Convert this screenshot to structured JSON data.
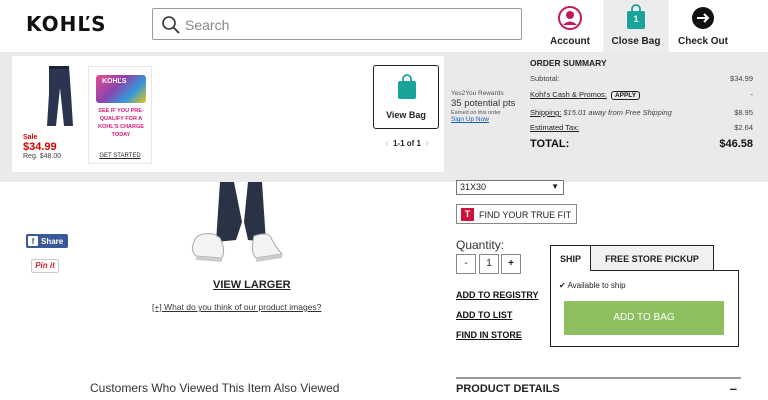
{
  "header": {
    "logo": "KOHĽS",
    "search_placeholder": "Search",
    "account_label": "Account",
    "close_bag_label": "Close Bag",
    "bag_count": "1",
    "checkout_label": "Check Out"
  },
  "bag": {
    "item": {
      "sale_label": "Sale",
      "sale_price": "$34.99",
      "reg_price": "Reg. $48.00"
    },
    "card_promo": {
      "logo_text": "KOHĽS",
      "text": "SEE IF YOU PRE-QUALIFY FOR A KOHL'S CHARGE TODAY",
      "cta": "GET STARTED"
    },
    "view_bag_label": "View Bag",
    "pager": "1-1 of 1"
  },
  "rewards": {
    "title": "Yes2You Rewards",
    "points": "35 potential pts",
    "note": "Earned on this order",
    "signup": "Sign Up Now"
  },
  "order_summary": {
    "title": "ORDER SUMMARY",
    "subtotal_label": "Subtotal:",
    "subtotal_value": "$34.99",
    "promos_label": "Kohl's Cash & Promos:",
    "apply_label": "APPLY",
    "promos_value": "-",
    "shipping_label": "Shipping:",
    "shipping_note": "$15.01 away from Free Shipping",
    "shipping_value": "$8.95",
    "tax_label": "Estimated Tax:",
    "tax_value": "$2.64",
    "total_label": "TOTAL:",
    "total_value": "$46.58"
  },
  "product": {
    "share_label": "Share",
    "pin_label": "Pin it",
    "view_larger": "VIEW LARGER",
    "feedback_link": "[+] What do you think of our product images?",
    "also_viewed": "Customers Who Viewed This Item Also Viewed",
    "size_value": "31X30",
    "truefit_label": "FIND YOUR TRUE FIT",
    "quantity_label": "Quantity:",
    "qty_minus": "-",
    "qty_value": "1",
    "qty_plus": "+",
    "add_to_registry": "ADD TO REGISTRY",
    "add_to_list": "ADD TO LIST",
    "find_in_store": "FIND IN STORE",
    "tab_ship": "SHIP",
    "tab_pickup": "FREE STORE PICKUP",
    "availability": "Available to ship",
    "add_to_bag": "ADD TO BAG",
    "product_details": "PRODUCT DETAILS",
    "collapse_symbol": "–"
  },
  "colors": {
    "accent_teal": "#1aa39b",
    "account_pink": "#c2185b",
    "add_to_bag_green": "#8dbf5f",
    "sale_red": "#dd0000"
  }
}
